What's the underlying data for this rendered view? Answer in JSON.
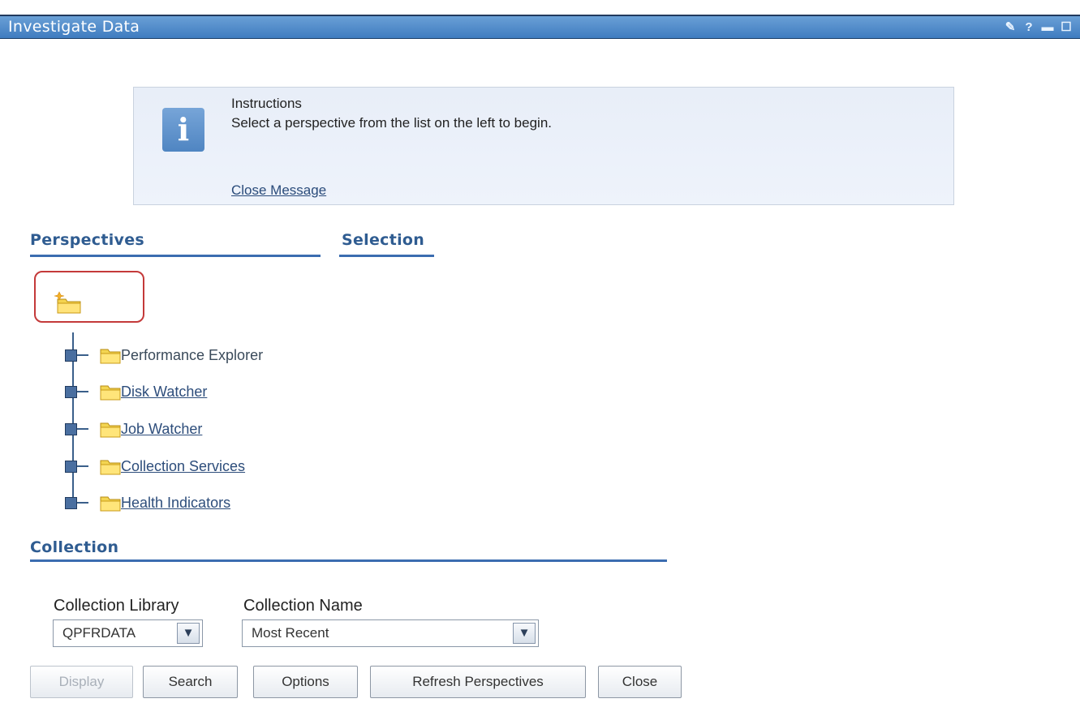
{
  "window": {
    "title": "Investigate Data",
    "tools": [
      "edit-icon",
      "help-icon",
      "minimize-icon",
      "maximize-icon"
    ]
  },
  "instructions": {
    "heading": "Instructions",
    "text": "Select a perspective from the list on the left to begin.",
    "close_label": "Close Message"
  },
  "sections": {
    "perspectives": "Perspectives",
    "selection": "Selection",
    "collection": "Collection"
  },
  "tree": {
    "items": [
      {
        "label": "Performance Explorer",
        "link": false
      },
      {
        "label": "Disk Watcher",
        "link": true
      },
      {
        "label": "Job Watcher",
        "link": true
      },
      {
        "label": "Collection Services",
        "link": true
      },
      {
        "label": "Health Indicators",
        "link": true
      }
    ]
  },
  "collection": {
    "library_label": "Collection Library",
    "library_value": "QPFRDATA",
    "name_label": "Collection Name",
    "name_value": "Most Recent"
  },
  "buttons": {
    "display": "Display",
    "search": "Search",
    "options": "Options",
    "refresh": "Refresh Perspectives",
    "close": "Close"
  },
  "colors": {
    "titlebar": "#3f7cc0",
    "heading": "#2f5c91",
    "highlight_border": "#c43a3a"
  }
}
